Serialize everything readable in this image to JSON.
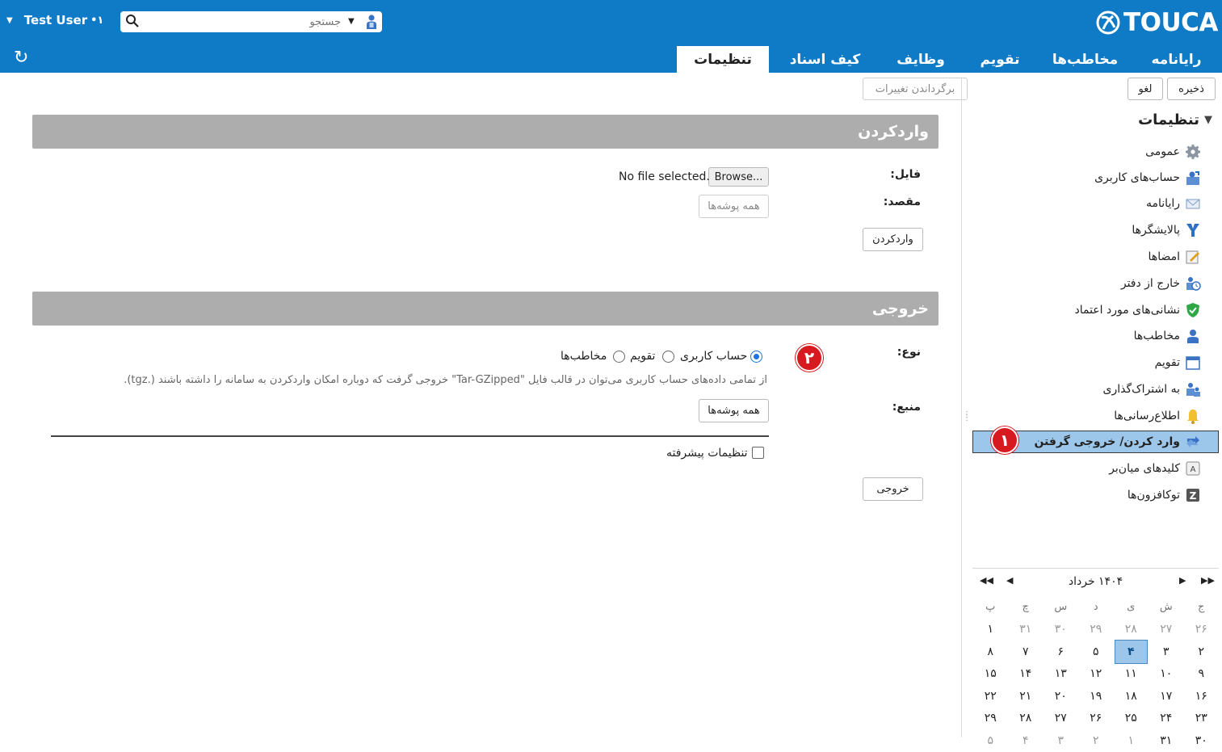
{
  "header": {
    "user_name": "Test User",
    "user_status": "•۱",
    "search_placeholder": "جستجو",
    "logo_text": "TOUCA",
    "refresh_icon": "refresh-icon"
  },
  "tabs": [
    {
      "label": "رایانامه",
      "active": false
    },
    {
      "label": "مخاطب‌ها",
      "active": false
    },
    {
      "label": "تقویم",
      "active": false
    },
    {
      "label": "وظایف",
      "active": false
    },
    {
      "label": "کیف اسناد",
      "active": false
    },
    {
      "label": "تنظیمات",
      "active": true
    }
  ],
  "toolbar": {
    "save_label": "ذخیره",
    "cancel_label": "لغو",
    "revert_label": "برگرداندن تغییرات"
  },
  "sidebar": {
    "title": "تنظیمات",
    "items": [
      {
        "label": "عمومی",
        "icon": "gear-icon"
      },
      {
        "label": "حساب‌های کاربری",
        "icon": "account-icon"
      },
      {
        "label": "رایانامه",
        "icon": "mail-icon"
      },
      {
        "label": "پالایشگرها",
        "icon": "filter-icon"
      },
      {
        "label": "امضاها",
        "icon": "signature-icon"
      },
      {
        "label": "خارج از دفتر",
        "icon": "out-of-office-icon"
      },
      {
        "label": "نشانی‌های مورد اعتماد",
        "icon": "shield-icon"
      },
      {
        "label": "مخاطب‌ها",
        "icon": "contact-icon"
      },
      {
        "label": "تقویم",
        "icon": "calendar-icon"
      },
      {
        "label": "به اشتراک‌گذاری",
        "icon": "share-icon"
      },
      {
        "label": "اطلاع‌رسانی‌ها",
        "icon": "bell-icon"
      },
      {
        "label": "وارد کردن/ خروجی گرفتن",
        "icon": "import-export-icon",
        "selected": true
      },
      {
        "label": "کلیدهای میان‌بر",
        "icon": "keyboard-icon"
      },
      {
        "label": "توکافزون‌ها",
        "icon": "zimlet-icon"
      }
    ],
    "badge_1": "۱",
    "badge_2": "۲"
  },
  "import_section": {
    "title": "واردکردن",
    "file_label": "فایل:",
    "browse_label": "Browse...",
    "no_file_text": "No file selected.",
    "destination_label": "مقصد:",
    "destination_value": "همه پوشه‌ها",
    "import_button": "واردکردن"
  },
  "export_section": {
    "title": "خروجی",
    "type_label": "نوع:",
    "type_options": [
      {
        "label": "حساب کاربری",
        "checked": true
      },
      {
        "label": "تقویم",
        "checked": false
      },
      {
        "label": "مخاطب‌ها",
        "checked": false
      }
    ],
    "description": "از تمامی داده‌های حساب کاربری می‌توان در قالب فایل \"Tar-GZipped\" خروجی گرفت که دوباره امکان واردکردن به سامانه را داشته باشند (.tgz).",
    "source_label": "منبع:",
    "source_value": "همه پوشه‌ها",
    "advanced_label": "تنظیمات پیشرفته",
    "advanced_checked": false,
    "export_button": "خروجی"
  },
  "calendar": {
    "title": "۱۴۰۴ خرداد",
    "weekdays": [
      "ش",
      "ی",
      "د",
      "س",
      "چ",
      "پ",
      "ج"
    ],
    "rows": [
      [
        {
          "d": "۲۷",
          "dim": true
        },
        {
          "d": "۲۸",
          "dim": true
        },
        {
          "d": "۲۹",
          "dim": true
        },
        {
          "d": "۳۰",
          "dim": true
        },
        {
          "d": "۳۱",
          "dim": true
        },
        {
          "d": "۱"
        },
        {
          "d": "۲۶",
          "dim": true
        }
      ],
      [
        {
          "d": "۳"
        },
        {
          "d": "۴",
          "today": true
        },
        {
          "d": "۵"
        },
        {
          "d": "۶"
        },
        {
          "d": "۷"
        },
        {
          "d": "۸"
        },
        {
          "d": "۲"
        }
      ],
      [
        {
          "d": "۱۰"
        },
        {
          "d": "۱۱"
        },
        {
          "d": "۱۲"
        },
        {
          "d": "۱۳"
        },
        {
          "d": "۱۴"
        },
        {
          "d": "۱۵"
        },
        {
          "d": "۹"
        }
      ],
      [
        {
          "d": "۱۷"
        },
        {
          "d": "۱۸"
        },
        {
          "d": "۱۹"
        },
        {
          "d": "۲۰"
        },
        {
          "d": "۲۱"
        },
        {
          "d": "۲۲"
        },
        {
          "d": "۱۶"
        }
      ],
      [
        {
          "d": "۲۴"
        },
        {
          "d": "۲۵"
        },
        {
          "d": "۲۶"
        },
        {
          "d": "۲۷"
        },
        {
          "d": "۲۸"
        },
        {
          "d": "۲۹"
        },
        {
          "d": "۲۳"
        }
      ],
      [
        {
          "d": "۳۱"
        },
        {
          "d": "۱",
          "dim": true
        },
        {
          "d": "۲",
          "dim": true
        },
        {
          "d": "۳",
          "dim": true
        },
        {
          "d": "۴",
          "dim": true
        },
        {
          "d": "۵",
          "dim": true
        },
        {
          "d": "۳۰"
        }
      ]
    ],
    "week_start_col": "ج"
  },
  "colors": {
    "brand_blue": "#0f7ac6",
    "selected_bg": "#9cc7ea",
    "section_gray": "#adadad",
    "badge_red": "#d71920"
  }
}
